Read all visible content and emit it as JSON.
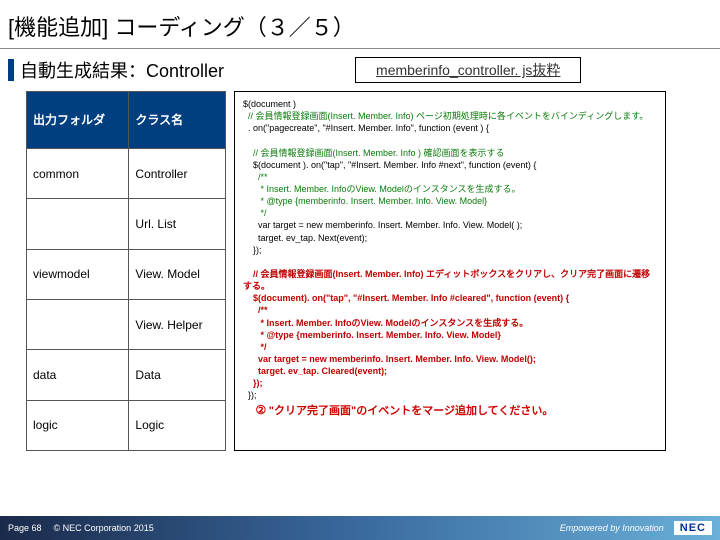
{
  "title": "[機能追加] コーディング（３／５）",
  "subtitle": "自動生成結果：Controller",
  "filename": "memberinfo_controller. js抜粋",
  "table": {
    "h1": "出力フォルダ",
    "h2": "クラス名",
    "rows": [
      {
        "folder": "common",
        "cls": "Controller"
      },
      {
        "folder": "",
        "cls": "Url. List"
      },
      {
        "folder": "viewmodel",
        "cls": "View. Model"
      },
      {
        "folder": "",
        "cls": "View. Helper"
      },
      {
        "folder": "data",
        "cls": "Data"
      },
      {
        "folder": "logic",
        "cls": "Logic"
      }
    ]
  },
  "code": {
    "l1": "$(document )",
    "c1": "  // 会員情報登録画面(Insert. Member. Info) ページ初期処理時に各イベントをバインディングします。",
    "l2": "  . on(\"pagecreate\", \"#Insert. Member. Info\", function (event ) {",
    "c2": "    // 会員情報登録画面(Insert. Member. Info ) 確認画面を表示する",
    "l3": "    $(document ). on(\"tap\", \"#Insert. Member. Info #next\", function (event) {",
    "c3": "      /**\n       * Insert. Member. InfoのView. Modelのインスタンスを生成する。\n       * @type {memberinfo. Insert. Member. Info. View. Model}\n       */",
    "l4": "      var target = new memberinfo. Insert. Member. Info. View. Model( );\n      target. ev_tap. Next(event);\n    });",
    "r1": "    // 会員情報登録画面(Insert. Member. Info) エディットボックスをクリアし、クリア完了画面に遷移する。",
    "r2": "    $(document). on(\"tap\", \"#Insert. Member. Info #cleared\", function (event) {",
    "r3": "      /**\n       * Insert. Member. InfoのView. Modelのインスタンスを生成する。\n       * @type {memberinfo. Insert. Member. Info. View. Model}\n       */",
    "r4": "      var target = new memberinfo. Insert. Member. Info. View. Model();\n      target. ev_tap. Cleared(event);\n    });",
    "l5": "  });",
    "note_num": "②",
    "note": "\"クリア完了画面\"のイベントをマージ追加してください。"
  },
  "footer": {
    "page": "Page 68",
    "copyright": "© NEC Corporation 2015",
    "tagline": "Empowered by Innovation",
    "logo": "NEC"
  }
}
